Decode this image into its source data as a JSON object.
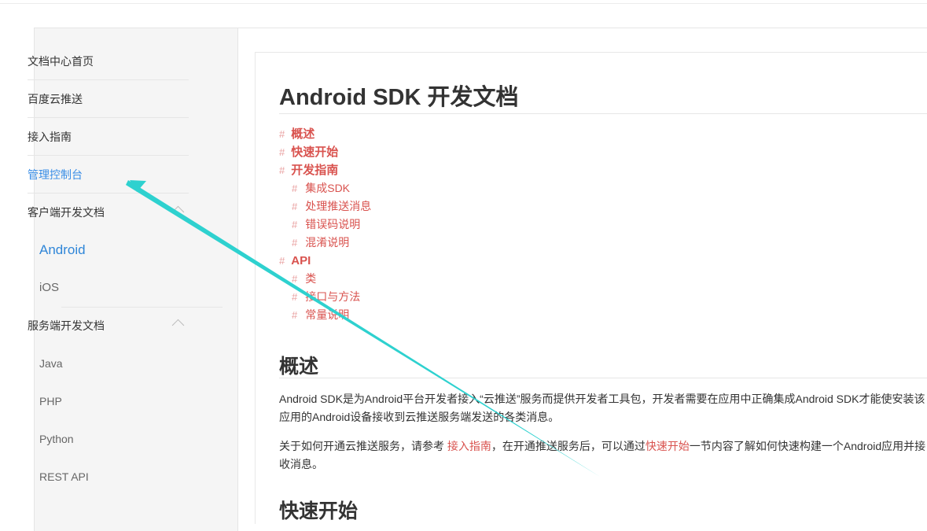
{
  "sidebar": {
    "items": [
      {
        "label": "文档中心首页"
      },
      {
        "label": "百度云推送"
      },
      {
        "label": "接入指南"
      },
      {
        "label": "管理控制台"
      },
      {
        "label": "客户端开发文档"
      },
      {
        "label": "服务端开发文档"
      }
    ],
    "client_sub": [
      {
        "label": "Android"
      },
      {
        "label": "iOS"
      }
    ],
    "server_sub": [
      {
        "label": "Java"
      },
      {
        "label": "PHP"
      },
      {
        "label": "Python"
      },
      {
        "label": "REST API"
      }
    ]
  },
  "main": {
    "title": "Android SDK 开发文档",
    "toc_hash": "#",
    "toc": [
      {
        "label": "概述"
      },
      {
        "label": "快速开始"
      },
      {
        "label": "开发指南"
      },
      {
        "label": "集成SDK"
      },
      {
        "label": "处理推送消息"
      },
      {
        "label": "错误码说明"
      },
      {
        "label": "混淆说明"
      },
      {
        "label": "API"
      },
      {
        "label": "类"
      },
      {
        "label": "接口与方法"
      },
      {
        "label": "常量说明"
      }
    ],
    "section1_title": "概述",
    "para1": "Android SDK是为Android平台开发者接入“云推送”服务而提供开发者工具包，开发者需要在应用中正确集成Android SDK才能使安装该应用的Android设备接收到云推送服务端发送的各类消息。",
    "para2": {
      "p1": "关于如何开通云推送服务，请参考 ",
      "link1": "接入指南",
      "p2": "，在开通推送服务后，可以通过",
      "link2": "快速开始",
      "p3": "一节内容了解如何快速构建一个Android应用并接收消息。"
    },
    "section2_title": "快速开始"
  },
  "colors": {
    "accent_blue": "#3a8ee6",
    "link_red": "#d9534f",
    "annotation_arrow": "#2ed1cf"
  }
}
